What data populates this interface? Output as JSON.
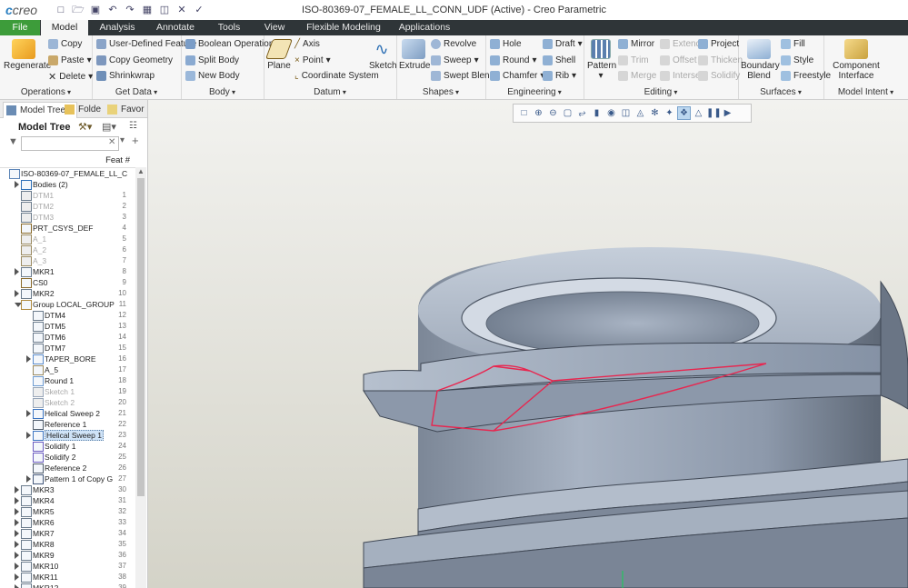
{
  "app": {
    "logo": "creo",
    "window_title": "ISO-80369-07_FEMALE_LL_CONN_UDF (Active) - Creo Parametric"
  },
  "tabs": [
    "File",
    "Model",
    "Analysis",
    "Annotate",
    "Tools",
    "View",
    "Flexible Modeling",
    "Applications"
  ],
  "ribbon": {
    "operations": {
      "label": "Operations",
      "regenerate": "Regenerate",
      "copy": "Copy",
      "paste": "Paste",
      "delete": "Delete"
    },
    "get_data": {
      "label": "Get Data",
      "udf": "User-Defined Feature",
      "copy_geometry": "Copy Geometry",
      "shrinkwrap": "Shrinkwrap"
    },
    "body": {
      "label": "Body",
      "boolean": "Boolean Operations",
      "split": "Split Body",
      "new": "New Body"
    },
    "datum": {
      "label": "Datum",
      "plane": "Plane",
      "axis": "Axis",
      "point": "Point",
      "csys": "Coordinate System",
      "sketch": "Sketch"
    },
    "shapes": {
      "label": "Shapes",
      "extrude": "Extrude",
      "revolve": "Revolve",
      "sweep": "Sweep",
      "swept_blend": "Swept Blend"
    },
    "engineering": {
      "label": "Engineering",
      "hole": "Hole",
      "round": "Round",
      "chamfer": "Chamfer",
      "draft": "Draft",
      "shell": "Shell",
      "rib": "Rib"
    },
    "editing": {
      "label": "Editing",
      "pattern": "Pattern",
      "mirror": "Mirror",
      "trim": "Trim",
      "merge": "Merge",
      "extend": "Extend",
      "offset": "Offset",
      "intersect": "Intersect",
      "project": "Project",
      "thicken": "Thicken",
      "solidify": "Solidify"
    },
    "surfaces": {
      "label": "Surfaces",
      "boundary_blend": "Boundary Blend",
      "fill": "Fill",
      "style": "Style",
      "freestyle": "Freestyle"
    },
    "model_intent": {
      "label": "Model Intent",
      "component_interface": "Component Interface"
    }
  },
  "navigator": {
    "tabs": [
      "Model Tree",
      "Folde",
      "Favor"
    ],
    "title": "Model Tree",
    "feat_col": "Feat #",
    "rows": [
      {
        "label": "ISO-80369-07_FEMALE_LL_C",
        "num": "",
        "indent": 0,
        "exp": "",
        "icon": "part",
        "dim": false,
        "sel": false
      },
      {
        "label": "Bodies (2)",
        "num": "",
        "indent": 1,
        "exp": "closed",
        "icon": "bodies",
        "dim": false,
        "sel": false
      },
      {
        "label": "DTM1",
        "num": "1",
        "indent": 1,
        "exp": "",
        "icon": "plane",
        "dim": true,
        "sel": false
      },
      {
        "label": "DTM2",
        "num": "2",
        "indent": 1,
        "exp": "",
        "icon": "plane",
        "dim": true,
        "sel": false
      },
      {
        "label": "DTM3",
        "num": "3",
        "indent": 1,
        "exp": "",
        "icon": "plane",
        "dim": true,
        "sel": false
      },
      {
        "label": "PRT_CSYS_DEF",
        "num": "4",
        "indent": 1,
        "exp": "",
        "icon": "csys",
        "dim": false,
        "sel": false
      },
      {
        "label": "A_1",
        "num": "5",
        "indent": 1,
        "exp": "",
        "icon": "axis",
        "dim": true,
        "sel": false
      },
      {
        "label": "A_2",
        "num": "6",
        "indent": 1,
        "exp": "",
        "icon": "axis",
        "dim": true,
        "sel": false
      },
      {
        "label": "A_3",
        "num": "7",
        "indent": 1,
        "exp": "",
        "icon": "axis",
        "dim": true,
        "sel": false
      },
      {
        "label": "MKR1",
        "num": "8",
        "indent": 1,
        "exp": "closed",
        "icon": "plane",
        "dim": false,
        "sel": false
      },
      {
        "label": "CS0",
        "num": "9",
        "indent": 1,
        "exp": "",
        "icon": "csys",
        "dim": false,
        "sel": false
      },
      {
        "label": "MKR2",
        "num": "10",
        "indent": 1,
        "exp": "closed",
        "icon": "plane",
        "dim": false,
        "sel": false
      },
      {
        "label": "Group LOCAL_GROUP",
        "num": "11",
        "indent": 1,
        "exp": "open",
        "icon": "group",
        "dim": false,
        "sel": false
      },
      {
        "label": "DTM4",
        "num": "12",
        "indent": 2,
        "exp": "",
        "icon": "plane",
        "dim": false,
        "sel": false
      },
      {
        "label": "DTM5",
        "num": "13",
        "indent": 2,
        "exp": "",
        "icon": "plane",
        "dim": false,
        "sel": false
      },
      {
        "label": "DTM6",
        "num": "14",
        "indent": 2,
        "exp": "",
        "icon": "plane",
        "dim": false,
        "sel": false
      },
      {
        "label": "DTM7",
        "num": "15",
        "indent": 2,
        "exp": "",
        "icon": "plane",
        "dim": false,
        "sel": false
      },
      {
        "label": "TAPER_BORE",
        "num": "16",
        "indent": 2,
        "exp": "closed",
        "icon": "revolve",
        "dim": false,
        "sel": false
      },
      {
        "label": "A_5",
        "num": "17",
        "indent": 2,
        "exp": "",
        "icon": "axis",
        "dim": false,
        "sel": false
      },
      {
        "label": "Round 1",
        "num": "18",
        "indent": 2,
        "exp": "",
        "icon": "round",
        "dim": false,
        "sel": false
      },
      {
        "label": "Sketch 1",
        "num": "19",
        "indent": 2,
        "exp": "",
        "icon": "sketch",
        "dim": true,
        "sel": false
      },
      {
        "label": "Sketch 2",
        "num": "20",
        "indent": 2,
        "exp": "",
        "icon": "sketch",
        "dim": true,
        "sel": false
      },
      {
        "label": "Helical Sweep 2",
        "num": "21",
        "indent": 2,
        "exp": "closed",
        "icon": "helical",
        "dim": false,
        "sel": false
      },
      {
        "label": "Reference 1",
        "num": "22",
        "indent": 2,
        "exp": "",
        "icon": "reference",
        "dim": false,
        "sel": false
      },
      {
        "label": "Helical Sweep 1",
        "num": "23",
        "indent": 2,
        "exp": "closed",
        "icon": "helical",
        "dim": false,
        "sel": true
      },
      {
        "label": "Solidify 1",
        "num": "24",
        "indent": 2,
        "exp": "",
        "icon": "solidify",
        "dim": false,
        "sel": false
      },
      {
        "label": "Solidify 2",
        "num": "25",
        "indent": 2,
        "exp": "",
        "icon": "solidify",
        "dim": false,
        "sel": false
      },
      {
        "label": "Reference 2",
        "num": "26",
        "indent": 2,
        "exp": "",
        "icon": "reference",
        "dim": false,
        "sel": false
      },
      {
        "label": "Pattern 1 of Copy G",
        "num": "27",
        "indent": 2,
        "exp": "closed",
        "icon": "pattern",
        "dim": false,
        "sel": false
      },
      {
        "label": "MKR3",
        "num": "30",
        "indent": 1,
        "exp": "closed",
        "icon": "plane",
        "dim": false,
        "sel": false
      },
      {
        "label": "MKR4",
        "num": "31",
        "indent": 1,
        "exp": "closed",
        "icon": "plane",
        "dim": false,
        "sel": false
      },
      {
        "label": "MKR5",
        "num": "32",
        "indent": 1,
        "exp": "closed",
        "icon": "plane",
        "dim": false,
        "sel": false
      },
      {
        "label": "MKR6",
        "num": "33",
        "indent": 1,
        "exp": "closed",
        "icon": "plane",
        "dim": false,
        "sel": false
      },
      {
        "label": "MKR7",
        "num": "34",
        "indent": 1,
        "exp": "closed",
        "icon": "plane",
        "dim": false,
        "sel": false
      },
      {
        "label": "MKR8",
        "num": "35",
        "indent": 1,
        "exp": "closed",
        "icon": "plane",
        "dim": false,
        "sel": false
      },
      {
        "label": "MKR9",
        "num": "36",
        "indent": 1,
        "exp": "closed",
        "icon": "plane",
        "dim": false,
        "sel": false
      },
      {
        "label": "MKR10",
        "num": "37",
        "indent": 1,
        "exp": "closed",
        "icon": "plane",
        "dim": false,
        "sel": false
      },
      {
        "label": "MKR11",
        "num": "38",
        "indent": 1,
        "exp": "closed",
        "icon": "plane",
        "dim": false,
        "sel": false
      },
      {
        "label": "MKR12",
        "num": "39",
        "indent": 1,
        "exp": "closed",
        "icon": "plane",
        "dim": false,
        "sel": false
      }
    ]
  },
  "colors": {
    "title_bar": "#ffffff",
    "tab_bar": "#2f3538",
    "file_tab": "#3d9c3a",
    "selection": "#e8264f",
    "viewport_top": "#f2f2ef",
    "viewport_bottom": "#d4d3c8",
    "model": "#9aa9bd"
  }
}
